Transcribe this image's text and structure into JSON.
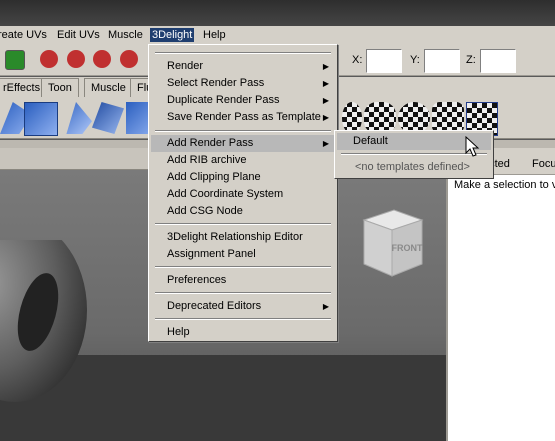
{
  "menubar": {
    "items": [
      "reate UVs",
      "Edit UVs",
      "Muscle",
      "3Delight",
      "Help"
    ]
  },
  "toolbar": {
    "coord_x_label": "X:",
    "coord_y_label": "Y:",
    "coord_z_label": "Z:"
  },
  "shelf_tabs": [
    "rEffects",
    "Toon",
    "Muscle",
    "Flu"
  ],
  "delight_menu": {
    "items": [
      {
        "label": "Render",
        "submenu": true
      },
      {
        "label": "Select Render Pass",
        "submenu": true
      },
      {
        "label": "Duplicate Render Pass",
        "submenu": true
      },
      {
        "label": "Save Render Pass as Template",
        "submenu": true
      },
      {
        "label": "Add Render Pass",
        "submenu": true,
        "highlighted": true
      },
      {
        "label": "Add RIB archive"
      },
      {
        "label": "Add Clipping Plane"
      },
      {
        "label": "Add Coordinate System"
      },
      {
        "label": "Add CSG Node"
      },
      {
        "label": "3Delight Relationship Editor"
      },
      {
        "label": "Assignment Panel"
      },
      {
        "label": "Preferences"
      },
      {
        "label": "Deprecated Editors",
        "submenu": true
      },
      {
        "label": "Help"
      }
    ]
  },
  "render_pass_submenu": {
    "items": [
      {
        "label": "Default",
        "highlighted": true
      },
      {
        "label": "<no templates defined>",
        "disabled": true
      }
    ]
  },
  "right_panel": {
    "header_left": "ected",
    "header_right": "Focus",
    "message": "Make a selection to v"
  },
  "viewcube": {
    "face_label": "FRONT"
  },
  "colors": {
    "menu_bg": "#d4d0c8",
    "menu_highlight": "#b8b8b8",
    "menubar_active": "#1f3e6f",
    "viewport": "#6e6e6e"
  }
}
